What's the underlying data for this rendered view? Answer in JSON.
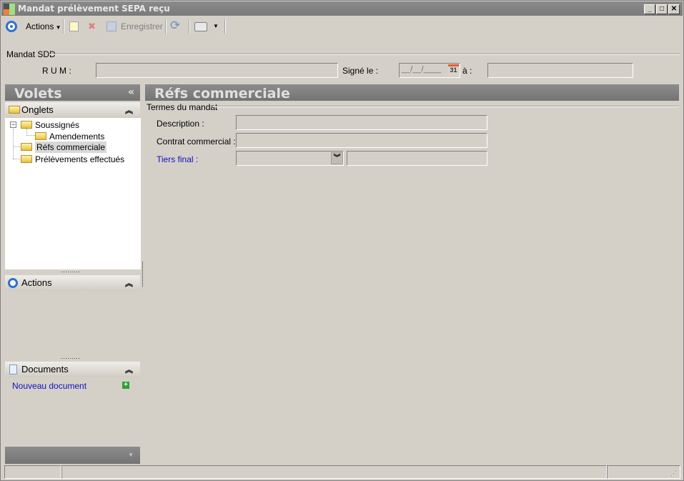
{
  "window": {
    "title": "Mandat prélèvement SEPA reçu",
    "min": "_",
    "max": "□",
    "close": "✕"
  },
  "toolbar": {
    "actions_label": "Actions",
    "save_label": "Enregistrer"
  },
  "header": {
    "group_label": "Mandat SDD",
    "rum_label": "R U M :",
    "rum_value": "",
    "signed_label": "Signé le :",
    "signed_value": "__/__/____",
    "calendar_day": "31",
    "place_label": "à :",
    "place_value": ""
  },
  "panes": {
    "title": "Volets",
    "collapse": "«",
    "tabs": {
      "title": "Onglets",
      "items": [
        {
          "label": "Soussignés"
        },
        {
          "label": "Amendements"
        },
        {
          "label": "Réfs commerciale"
        },
        {
          "label": "Prélèvements effectués"
        }
      ]
    },
    "actions": {
      "title": "Actions"
    },
    "documents": {
      "title": "Documents",
      "new_doc": "Nouveau document"
    }
  },
  "main": {
    "title": "Réfs commerciale",
    "group_label": "Termes du mandat",
    "fields": [
      {
        "label": "Description :",
        "value": ""
      },
      {
        "label": "Contrat commercial :",
        "value": ""
      },
      {
        "label": "Tiers final :",
        "value": "",
        "value2": ""
      }
    ]
  }
}
